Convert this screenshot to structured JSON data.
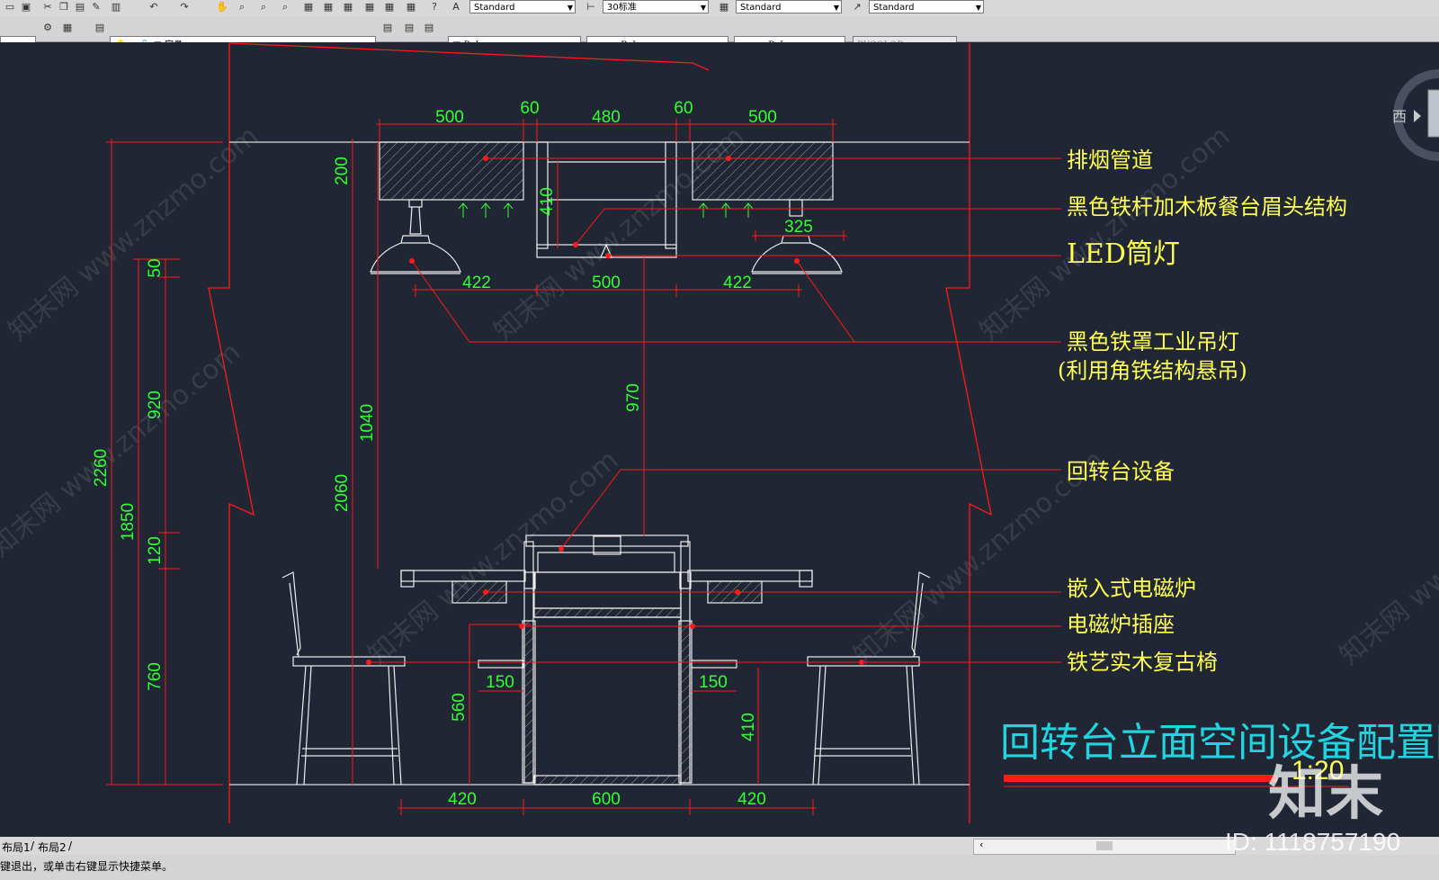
{
  "toolbar": {
    "text_style": "Standard",
    "dim_style": "30标准",
    "table_style": "Standard",
    "multileader_style": "Standard",
    "layer": "家具",
    "color": "ByLayer",
    "linetype": "ByLayer",
    "lineweight": "ByLayer",
    "plot_style": "BYCOLOR"
  },
  "drawing": {
    "title": "回转台立面空间设备配置图",
    "scale": "1:20",
    "top_dims": [
      "500",
      "60",
      "480",
      "60",
      "500"
    ],
    "mid_dims": [
      "422",
      "500",
      "422"
    ],
    "bottom_dims": [
      "420",
      "600",
      "420"
    ],
    "left_dims": [
      "2260",
      "1850",
      "50",
      "920",
      "120",
      "760",
      "2060",
      "1040",
      "200",
      "410"
    ],
    "inner_dims": [
      "970",
      "325",
      "150",
      "150",
      "560",
      "410"
    ],
    "labels": [
      "排烟管道",
      "黑色铁杆加木板餐台眉头结构",
      "LED筒灯",
      "黑色铁罩工业吊灯",
      "(利用角铁结构悬吊)",
      "回转台设备",
      "嵌入式电磁炉",
      "电磁炉插座",
      "铁艺实木复古椅"
    ]
  },
  "viewcube": {
    "direction": "西"
  },
  "layout_tabs": [
    "布局1",
    "布局2"
  ],
  "command_line": "键退出，或单击右键显示快捷菜单。",
  "watermark": {
    "brand": "知末",
    "id": "ID: 1118757190",
    "text": "知末网 www.znzmo.com"
  },
  "colors": {
    "background": "#202633",
    "red": "#ff1a1a",
    "green": "#33ff33",
    "yellow": "#ffff55",
    "white": "#ffffff",
    "cyan": "#22d3e0"
  }
}
